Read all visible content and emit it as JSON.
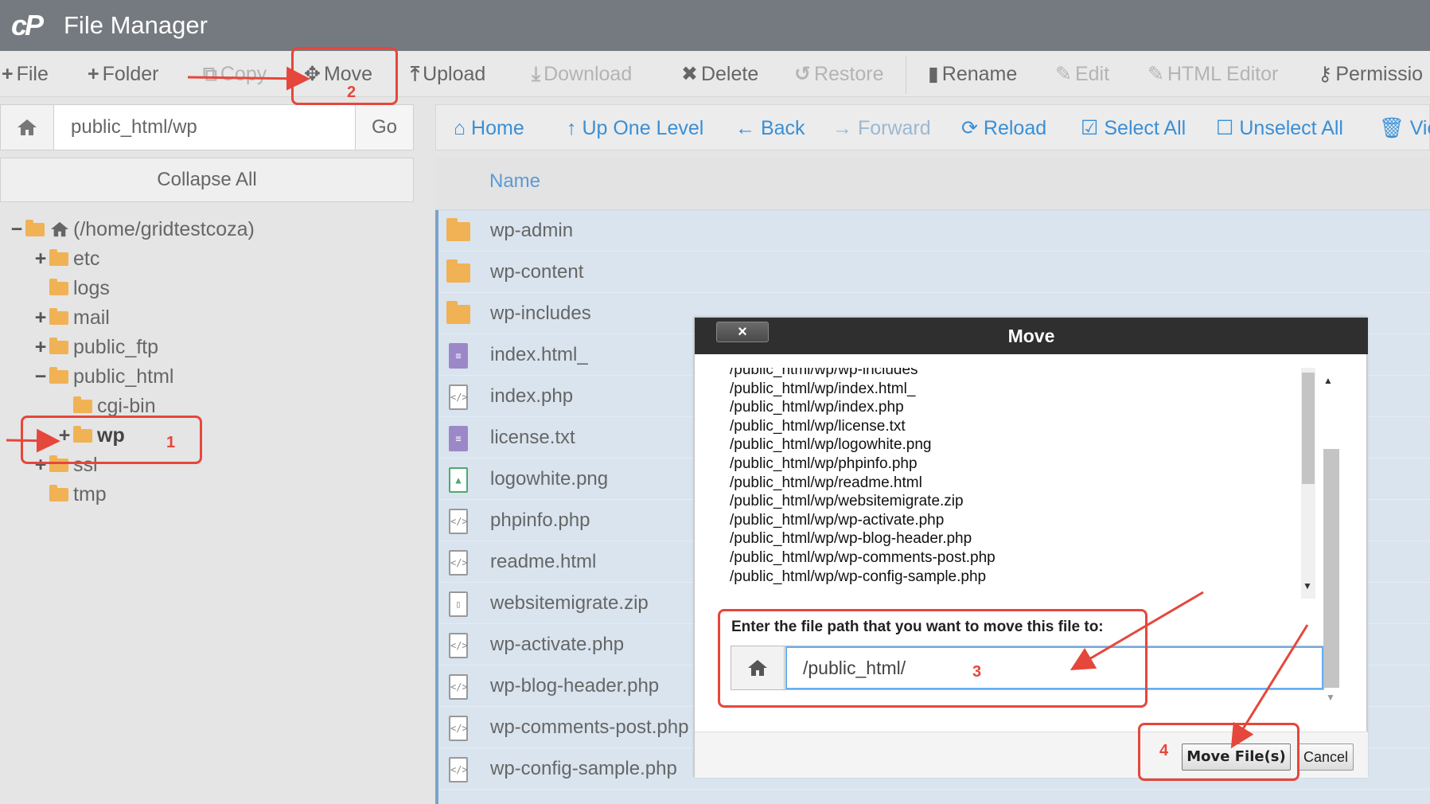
{
  "app": {
    "title": "File Manager",
    "logo_text": "cP"
  },
  "toolbar": {
    "file": "File",
    "folder": "Folder",
    "copy": "Copy",
    "move": "Move",
    "upload": "Upload",
    "download": "Download",
    "delete": "Delete",
    "restore": "Restore",
    "rename": "Rename",
    "edit": "Edit",
    "html_editor": "HTML Editor",
    "permissions": "Permissio"
  },
  "pathbar": {
    "value": "public_html/wp",
    "go_label": "Go"
  },
  "collapse_all": "Collapse All",
  "tree": [
    {
      "toggle": "−",
      "label": "(/home/gridtestcoza)"
    },
    {
      "toggle": "+",
      "label": "etc"
    },
    {
      "toggle": "",
      "label": "logs"
    },
    {
      "toggle": "+",
      "label": "mail"
    },
    {
      "toggle": "+",
      "label": "public_ftp"
    },
    {
      "toggle": "−",
      "label": "public_html"
    },
    {
      "toggle": "",
      "label": "cgi-bin"
    },
    {
      "toggle": "+",
      "label": "wp"
    },
    {
      "toggle": "+",
      "label": "ssl"
    },
    {
      "toggle": "",
      "label": "tmp"
    }
  ],
  "nav": {
    "home": "Home",
    "up_one_level": "Up One Level",
    "back": "Back",
    "forward": "Forward",
    "reload": "Reload",
    "select_all": "Select All",
    "unselect_all": "Unselect All",
    "view": "View"
  },
  "file_list": {
    "column_name": "Name",
    "files": [
      {
        "name": "wp-admin",
        "type": "folder"
      },
      {
        "name": "wp-content",
        "type": "folder"
      },
      {
        "name": "wp-includes",
        "type": "folder"
      },
      {
        "name": "index.html_",
        "type": "text"
      },
      {
        "name": "index.php",
        "type": "code"
      },
      {
        "name": "license.txt",
        "type": "text"
      },
      {
        "name": "logowhite.png",
        "type": "image"
      },
      {
        "name": "phpinfo.php",
        "type": "code"
      },
      {
        "name": "readme.html",
        "type": "code"
      },
      {
        "name": "websitemigrate.zip",
        "type": "zip"
      },
      {
        "name": "wp-activate.php",
        "type": "code"
      },
      {
        "name": "wp-blog-header.php",
        "type": "code"
      },
      {
        "name": "wp-comments-post.php",
        "type": "code"
      },
      {
        "name": "wp-config-sample.php",
        "type": "code"
      }
    ]
  },
  "dialog": {
    "title": "Move",
    "close_label": "×",
    "files": [
      "/public_html/wp/wp-includes",
      "/public_html/wp/index.html_",
      "/public_html/wp/index.php",
      "/public_html/wp/license.txt",
      "/public_html/wp/logowhite.png",
      "/public_html/wp/phpinfo.php",
      "/public_html/wp/readme.html",
      "/public_html/wp/websitemigrate.zip",
      "/public_html/wp/wp-activate.php",
      "/public_html/wp/wp-blog-header.php",
      "/public_html/wp/wp-comments-post.php",
      "/public_html/wp/wp-config-sample.php"
    ],
    "prompt": "Enter the file path that you want to move this file to:",
    "path_value": "/public_html/",
    "move_button": "Move File(s)",
    "cancel_button": "Cancel"
  },
  "annotations": [
    "1",
    "2",
    "3",
    "4"
  ],
  "colors": {
    "header_bg": "#757a80",
    "accent": "#3a8fd6",
    "annotation": "#e5473c",
    "folder": "#f0b255"
  }
}
